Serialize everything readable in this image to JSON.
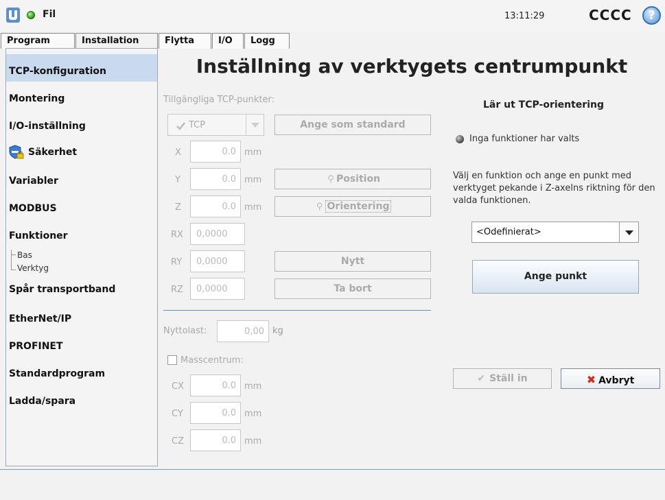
{
  "topbar": {
    "file_menu": "Fil",
    "clock": "13:11:29",
    "robot_name": "CCCC",
    "help_label": "?"
  },
  "tabs": [
    {
      "label": "Program"
    },
    {
      "label": "Installation"
    },
    {
      "label": "Flytta"
    },
    {
      "label": "I/O"
    },
    {
      "label": "Logg"
    }
  ],
  "sidebar": {
    "items": [
      {
        "label": "TCP-konfiguration"
      },
      {
        "label": "Montering"
      },
      {
        "label": "I/O-inställning"
      },
      {
        "label": "Säkerhet"
      },
      {
        "label": "Variabler"
      },
      {
        "label": "MODBUS"
      },
      {
        "label": "Funktioner"
      },
      {
        "label": "Spår transportband"
      },
      {
        "label": "EtherNet/IP"
      },
      {
        "label": "PROFINET"
      },
      {
        "label": "Standardprogram"
      },
      {
        "label": "Ladda/spara"
      }
    ],
    "sub_items": [
      {
        "label": "Bas"
      },
      {
        "label": "Verktyg"
      }
    ]
  },
  "main": {
    "title": "Inställning av verktygets centrumpunkt",
    "available_tcp_label": "Tillgängliga TCP-punkter:",
    "tcp_select_value": "TCP",
    "set_default_button": "Ange som standard",
    "fields": [
      {
        "label": "X",
        "value": "0.0",
        "unit": "mm"
      },
      {
        "label": "Y",
        "value": "0.0",
        "unit": "mm"
      },
      {
        "label": "Z",
        "value": "0.0",
        "unit": "mm"
      },
      {
        "label": "RX",
        "value": "0,0000"
      },
      {
        "label": "RY",
        "value": "0,0000"
      },
      {
        "label": "RZ",
        "value": "0,0000"
      }
    ],
    "position_button": "Position",
    "orientation_button": "Orientering",
    "new_button": "Nytt",
    "remove_button": "Ta bort",
    "payload_label": "Nyttolast:",
    "payload_value": "0,00",
    "payload_unit": "kg",
    "center_of_mass_label": "Masscentrum:",
    "com_fields": [
      {
        "label": "CX",
        "value": "0.0",
        "unit": "mm"
      },
      {
        "label": "CY",
        "value": "0.0",
        "unit": "mm"
      },
      {
        "label": "CZ",
        "value": "0.0",
        "unit": "mm"
      }
    ]
  },
  "right_panel": {
    "heading": "Lär ut TCP-orientering",
    "status_text": "Inga funktioner har valts",
    "hint_text": "Välj en funktion och ange en punkt med verktyget pekande i Z-axelns riktning för den valda funktionen.",
    "feature_select_value": "<Odefinierat>",
    "set_point_button": "Ange punkt",
    "apply_button": "Ställ in",
    "cancel_button": "Avbryt"
  }
}
